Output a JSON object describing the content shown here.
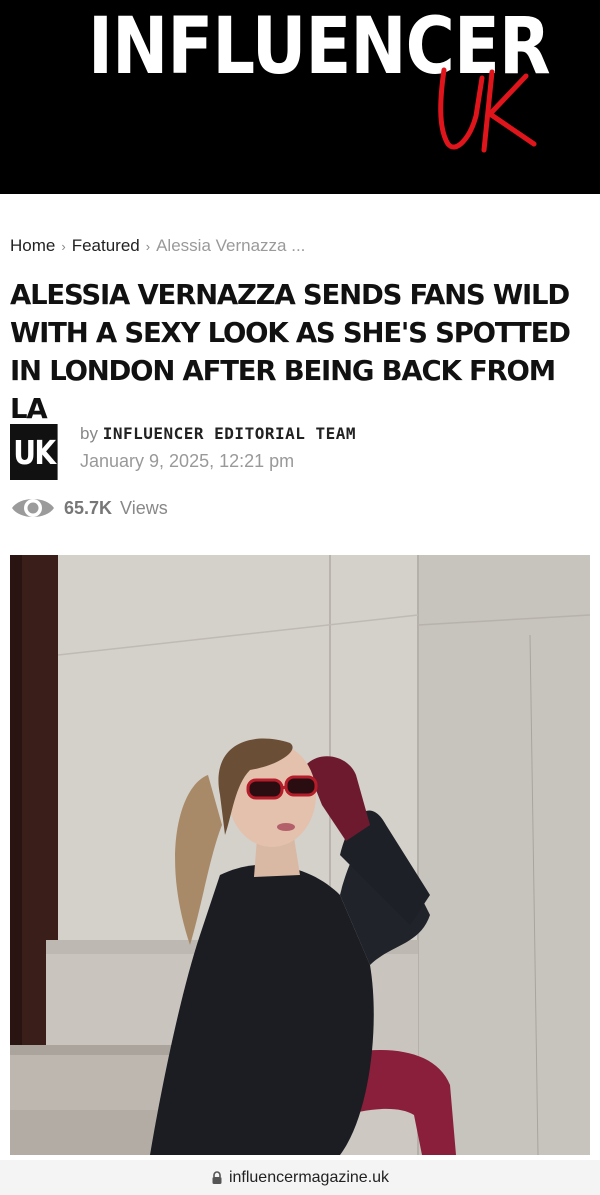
{
  "masthead": {
    "logo_main": "INFLUENCER",
    "logo_script": "UK"
  },
  "breadcrumb": {
    "items": [
      "Home",
      "Featured"
    ],
    "current": "Alessia Vernazza ...",
    "separator": "›"
  },
  "article": {
    "headline": "ALESSIA VERNAZZA SENDS FANS WILD WITH A SEXY LOOK AS SHE'S SPOTTED IN LONDON AFTER BEING BACK FROM LA",
    "author_logo": "UK",
    "by_prefix": "by",
    "author": "INFLUENCER EDITORIAL TEAM",
    "date": "January 9, 2025, 12:21 pm",
    "views_count": "65.7K",
    "views_label": "Views"
  },
  "browser": {
    "url": "influencermagazine.uk"
  },
  "colors": {
    "masthead_bg": "#000000",
    "logo_script": "#e0151c",
    "headline": "#111111",
    "meta_grey": "#888888"
  },
  "icons": {
    "views": "eye-icon",
    "url_lock": "lock-icon"
  }
}
